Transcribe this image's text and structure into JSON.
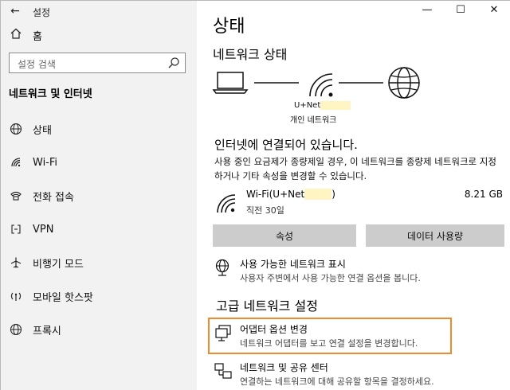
{
  "app": {
    "title": "설정"
  },
  "window_controls": {
    "minimize": "—",
    "maximize": "☐",
    "close": "✕"
  },
  "sidebar": {
    "home_label": "홈",
    "search_placeholder": "설정 검색",
    "section_title": "네트워크 및 인터넷",
    "items": [
      {
        "label": "상태",
        "icon": "globe-status-icon"
      },
      {
        "label": "Wi-Fi",
        "icon": "wifi-icon"
      },
      {
        "label": "전화 접속",
        "icon": "dialup-icon"
      },
      {
        "label": "VPN",
        "icon": "vpn-icon"
      },
      {
        "label": "비행기 모드",
        "icon": "airplane-icon"
      },
      {
        "label": "모바일 핫스팟",
        "icon": "hotspot-icon"
      },
      {
        "label": "프록시",
        "icon": "proxy-globe-icon"
      }
    ]
  },
  "main": {
    "title": "상태",
    "network_status_heading": "네트워크 상태",
    "diagram": {
      "network_name": "U+Net",
      "network_type": "개인 네트워크"
    },
    "connection_heading": "인터넷에 연결되어 있습니다.",
    "connection_desc": "사용 중인 요금제가 종량제일 경우, 이 네트워크를 종량제 네트워크로 지정하거나 기타 속성을 변경할 수 있습니다.",
    "wifi": {
      "name": "Wi-Fi(U+Net",
      "name_suffix": ")",
      "sub": "직전 30일",
      "usage": "8.21 GB"
    },
    "buttons": {
      "properties": "속성",
      "data_usage": "데이터 사용량"
    },
    "show_networks": {
      "title": "사용 가능한 네트워크 표시",
      "desc": "사용자 주변에서 사용 가능한 연결 옵션을 봅니다."
    },
    "advanced_heading": "고급 네트워크 설정",
    "adapter_options": {
      "title": "어댑터 옵션 변경",
      "desc": "네트워크 어댑터를 보고 연결 설정을 변경합니다."
    },
    "sharing_center": {
      "title": "네트워크 및 공유 센터",
      "desc": "연결하는 네트워크에 대해 공유할 항목을 결정하세요."
    }
  },
  "colors": {
    "highlight": "#ef8a2d",
    "sidebar_bg": "#f2f2f2",
    "button_bg": "#cccccc"
  }
}
